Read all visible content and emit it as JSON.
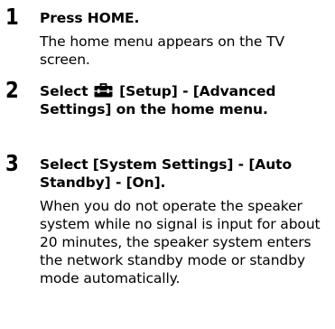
{
  "steps": [
    {
      "number": "1",
      "title": "Press HOME.",
      "body": "The home menu appears on the TV screen."
    },
    {
      "number": "2",
      "title_prefix": "Select",
      "icon": "toolbox-icon",
      "title_suffix": "[Setup] - [Advanced Settings] on the home menu."
    },
    {
      "number": "3",
      "title": "Select [System Settings] - [Auto Standby] - [On].",
      "body": "When you do not operate the speaker system while no signal is input for about 20 minutes, the speaker system enters the network standby mode or standby mode automatically."
    }
  ]
}
